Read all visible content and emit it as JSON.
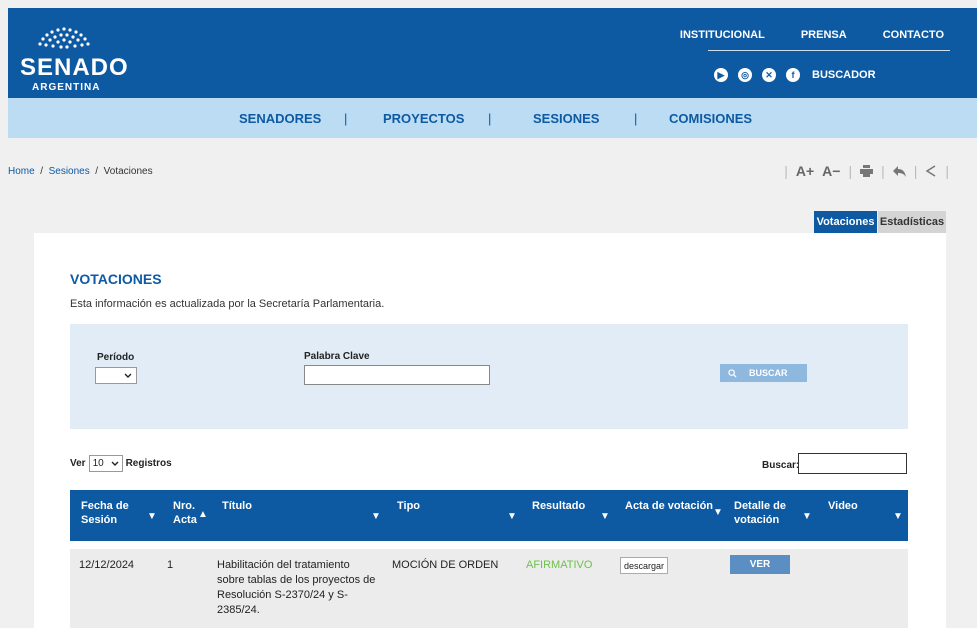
{
  "header": {
    "logo_title": "SENADO",
    "logo_subtitle": "ARGENTINA",
    "links": [
      "INSTITUCIONAL",
      "PRENSA",
      "CONTACTO"
    ],
    "social_icons": [
      "youtube-icon",
      "instagram-icon",
      "x-icon",
      "facebook-icon"
    ],
    "buscador": "BUSCADOR"
  },
  "nav": {
    "items": [
      "SENADORES",
      "PROYECTOS",
      "SESIONES",
      "COMISIONES"
    ]
  },
  "breadcrumb": {
    "home": "Home",
    "sep": "/",
    "sesiones": "Sesiones",
    "current": "Votaciones"
  },
  "tools": {
    "font_up": "A+",
    "font_down": "A−"
  },
  "tabs": {
    "active": "Votaciones",
    "inactive": "Estadísticas"
  },
  "section": {
    "title": "VOTACIONES",
    "description": "Esta información es actualizada por la Secretaría Parlamentaria."
  },
  "filters": {
    "periodo_label": "Período",
    "periodo_value": "",
    "palabra_label": "Palabra Clave",
    "palabra_value": "",
    "search_button": "BUSCAR"
  },
  "list_controls": {
    "ver_label": "Ver",
    "ver_value": "10",
    "registros_label": "Registros",
    "buscar_label": "Buscar:"
  },
  "table": {
    "headers": {
      "fecha_1": "Fecha de",
      "fecha_2": "Sesión",
      "nro_1": "Nro.",
      "nro_2": "Acta",
      "titulo": "Título",
      "tipo": "Tipo",
      "resultado": "Resultado",
      "acta": "Acta de votación",
      "detalle_1": "Detalle de",
      "detalle_2": "votación",
      "video": "Video"
    },
    "rows": [
      {
        "fecha": "12/12/2024",
        "nro": "1",
        "titulo_1": "Habilitación del tratamiento",
        "titulo_2": "sobre tablas de los proyectos de",
        "titulo_3": "Resolución S-2370/24 y S-",
        "titulo_4": "2385/24.",
        "tipo": "MOCIÓN DE ORDEN",
        "resultado": "AFIRMATIVO",
        "acta_button": "descargar",
        "detalle_button": "VER"
      }
    ]
  }
}
